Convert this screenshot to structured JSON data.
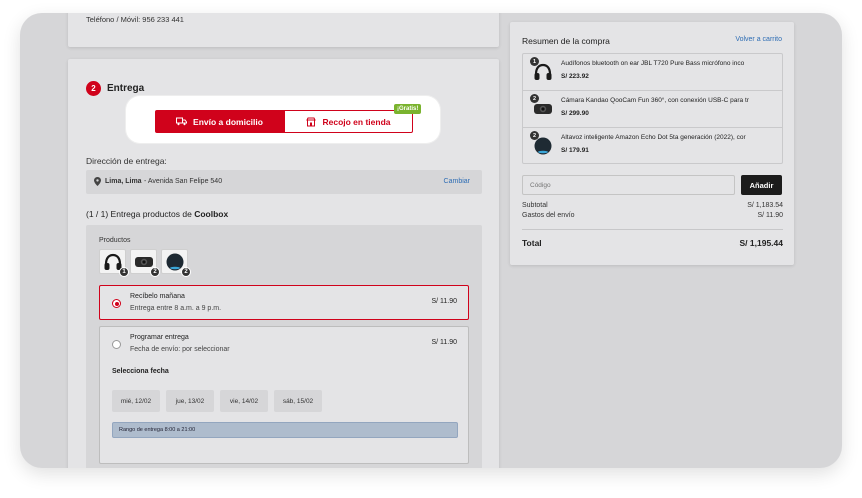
{
  "contact": {
    "phone": "Teléfono / Móvil: 956 233 441"
  },
  "step": {
    "number": "2",
    "title": "Entrega"
  },
  "delivery_toggle": {
    "home_label": "Envío a domicilio",
    "store_label": "Recojo en tienda",
    "free_badge": "¡Gratis!"
  },
  "address": {
    "label": "Dirección de entrega:",
    "city": "Lima, Lima",
    "street": "- Avenida San Felipe 540",
    "change_label": "Cambiar"
  },
  "delivery": {
    "count": "(1 / 1) Entrega productos de",
    "store": "Coolbox"
  },
  "products": {
    "label": "Productos",
    "thumbnails": [
      {
        "icon": "headphones-icon",
        "qty": "1"
      },
      {
        "icon": "camera-icon",
        "qty": "2"
      },
      {
        "icon": "smart-speaker-icon",
        "qty": "2"
      }
    ]
  },
  "options": {
    "tomorrow": {
      "title": "Recíbelo mañana",
      "subtitle": "Entrega entre 8 a.m. a 9 p.m.",
      "price": "S/ 11.90",
      "selected": true
    },
    "schedule": {
      "title": "Programar entrega",
      "subtitle": "Fecha de envío: por seleccionar",
      "price": "S/ 11.90",
      "selected": false
    },
    "select_date_label": "Selecciona fecha",
    "dates": [
      "mié, 12/02",
      "jue, 13/02",
      "vie, 14/02",
      "sáb, 15/02"
    ],
    "range_label": "Rango de entrega 8:00 a 21:00"
  },
  "summary": {
    "title": "Resumen de la compra",
    "back_to_cart": "Volver a carrito",
    "items": [
      {
        "qty": "1",
        "name": "Audífonos bluetooth on ear JBL T720 Pure Bass micrófono inco",
        "price": "S/ 223.92",
        "icon": "headphones-icon"
      },
      {
        "qty": "2",
        "name": "Cámara Kandao QooCam Fun 360°, con conexión USB-C para tr",
        "price": "S/ 299.90",
        "icon": "camera-icon"
      },
      {
        "qty": "2",
        "name": "Altavoz inteligente Amazon Echo Dot 5ta generación (2022), cor",
        "price": "S/ 179.91",
        "icon": "smart-speaker-icon"
      }
    ],
    "code_placeholder": "Código",
    "add_label": "Añadir",
    "subtotal_label": "Subtotal",
    "subtotal_value": "S/ 1,183.54",
    "shipping_label": "Gastos del envío",
    "shipping_value": "S/ 11.90",
    "total_label": "Total",
    "total_value": "S/ 1,195.44"
  },
  "colors": {
    "accent": "#d0021b",
    "link": "#2e6db4",
    "free_badge": "#7ab32e",
    "dark_button": "#1c1c1c"
  }
}
